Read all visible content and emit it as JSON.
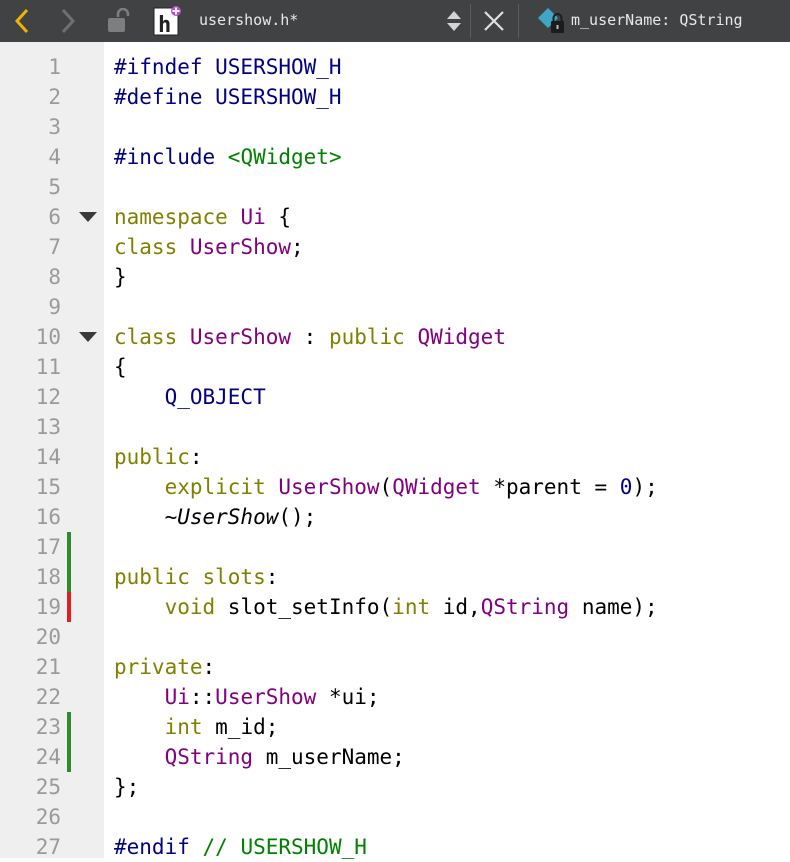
{
  "toolbar": {
    "back_icon": "chevron-left-icon",
    "forward_icon": "chevron-right-icon",
    "lock_icon": "unlock-icon",
    "file_icon": "header-file-icon",
    "file_name": "usershow.h*",
    "close_icon": "close-icon",
    "symbol_icon": "class-member-icon",
    "symbol_name": "m_userName: QString"
  },
  "colors": {
    "toolbar_bg": "#404244",
    "gutter_bg": "#efefef",
    "line_number": "#9a9a9a",
    "preprocessor": "#000080",
    "keyword": "#808000",
    "type": "#800080",
    "string": "#008000",
    "comment": "#008000",
    "modified_marker": "#2e8b2e",
    "removed_marker": "#e02020",
    "nav_arrow_active": "#f0b400"
  },
  "editor": {
    "lines": [
      {
        "n": "1",
        "tokens": [
          [
            "pp",
            "#ifndef USERSHOW_H"
          ]
        ]
      },
      {
        "n": "2",
        "tokens": [
          [
            "pp",
            "#define USERSHOW_H"
          ]
        ]
      },
      {
        "n": "3",
        "tokens": []
      },
      {
        "n": "4",
        "tokens": [
          [
            "pp",
            "#include "
          ],
          [
            "st",
            "<QWidget>"
          ]
        ]
      },
      {
        "n": "5",
        "tokens": []
      },
      {
        "n": "6",
        "fold": true,
        "tokens": [
          [
            "kw",
            "namespace "
          ],
          [
            "ty",
            "Ui"
          ],
          [
            "pl",
            " {"
          ]
        ]
      },
      {
        "n": "7",
        "tokens": [
          [
            "kw",
            "class "
          ],
          [
            "ty",
            "UserShow"
          ],
          [
            "pl",
            ";"
          ]
        ]
      },
      {
        "n": "8",
        "tokens": [
          [
            "pl",
            "}"
          ]
        ]
      },
      {
        "n": "9",
        "tokens": []
      },
      {
        "n": "10",
        "fold": true,
        "tokens": [
          [
            "kw",
            "class "
          ],
          [
            "ty",
            "UserShow"
          ],
          [
            "pl",
            " : "
          ],
          [
            "kw",
            "public "
          ],
          [
            "ty",
            "QWidget"
          ]
        ]
      },
      {
        "n": "11",
        "tokens": [
          [
            "pl",
            "{"
          ]
        ]
      },
      {
        "n": "12",
        "tokens": [
          [
            "pl",
            "    "
          ],
          [
            "pp",
            "Q_OBJECT"
          ]
        ]
      },
      {
        "n": "13",
        "tokens": []
      },
      {
        "n": "14",
        "tokens": [
          [
            "kw",
            "public"
          ],
          [
            "pl",
            ":"
          ]
        ]
      },
      {
        "n": "15",
        "tokens": [
          [
            "pl",
            "    "
          ],
          [
            "kw",
            "explicit "
          ],
          [
            "ty",
            "UserShow"
          ],
          [
            "pl",
            "("
          ],
          [
            "ty",
            "QWidget"
          ],
          [
            "pl",
            " *parent = "
          ],
          [
            "num",
            "0"
          ],
          [
            "pl",
            ");"
          ]
        ]
      },
      {
        "n": "16",
        "tokens": [
          [
            "pl",
            "    ~"
          ],
          [
            "it",
            "UserShow"
          ],
          [
            "pl",
            "();"
          ]
        ]
      },
      {
        "n": "17",
        "mark": "modified",
        "tokens": []
      },
      {
        "n": "18",
        "mark": "modified",
        "tokens": [
          [
            "kw",
            "public slots"
          ],
          [
            "pl",
            ":"
          ]
        ]
      },
      {
        "n": "19",
        "mark": "removed",
        "tokens": [
          [
            "pl",
            "    "
          ],
          [
            "kw",
            "void "
          ],
          [
            "pl",
            "slot_setInfo("
          ],
          [
            "kw",
            "int "
          ],
          [
            "pl",
            "id,"
          ],
          [
            "ty",
            "QString"
          ],
          [
            "pl",
            " name);"
          ]
        ]
      },
      {
        "n": "20",
        "tokens": []
      },
      {
        "n": "21",
        "tokens": [
          [
            "kw",
            "private"
          ],
          [
            "pl",
            ":"
          ]
        ]
      },
      {
        "n": "22",
        "tokens": [
          [
            "pl",
            "    "
          ],
          [
            "ty",
            "Ui"
          ],
          [
            "pl",
            "::"
          ],
          [
            "ty",
            "UserShow"
          ],
          [
            "pl",
            " *ui;"
          ]
        ]
      },
      {
        "n": "23",
        "mark": "modified",
        "tokens": [
          [
            "pl",
            "    "
          ],
          [
            "kw",
            "int "
          ],
          [
            "pl",
            "m_id;"
          ]
        ]
      },
      {
        "n": "24",
        "mark": "modified",
        "tokens": [
          [
            "pl",
            "    "
          ],
          [
            "ty",
            "QString"
          ],
          [
            "pl",
            " m_userName;"
          ]
        ]
      },
      {
        "n": "25",
        "tokens": [
          [
            "pl",
            "};"
          ]
        ]
      },
      {
        "n": "26",
        "tokens": []
      },
      {
        "n": "27",
        "tokens": [
          [
            "pp",
            "#endif "
          ],
          [
            "cm",
            "// USERSHOW_H"
          ]
        ]
      }
    ]
  }
}
